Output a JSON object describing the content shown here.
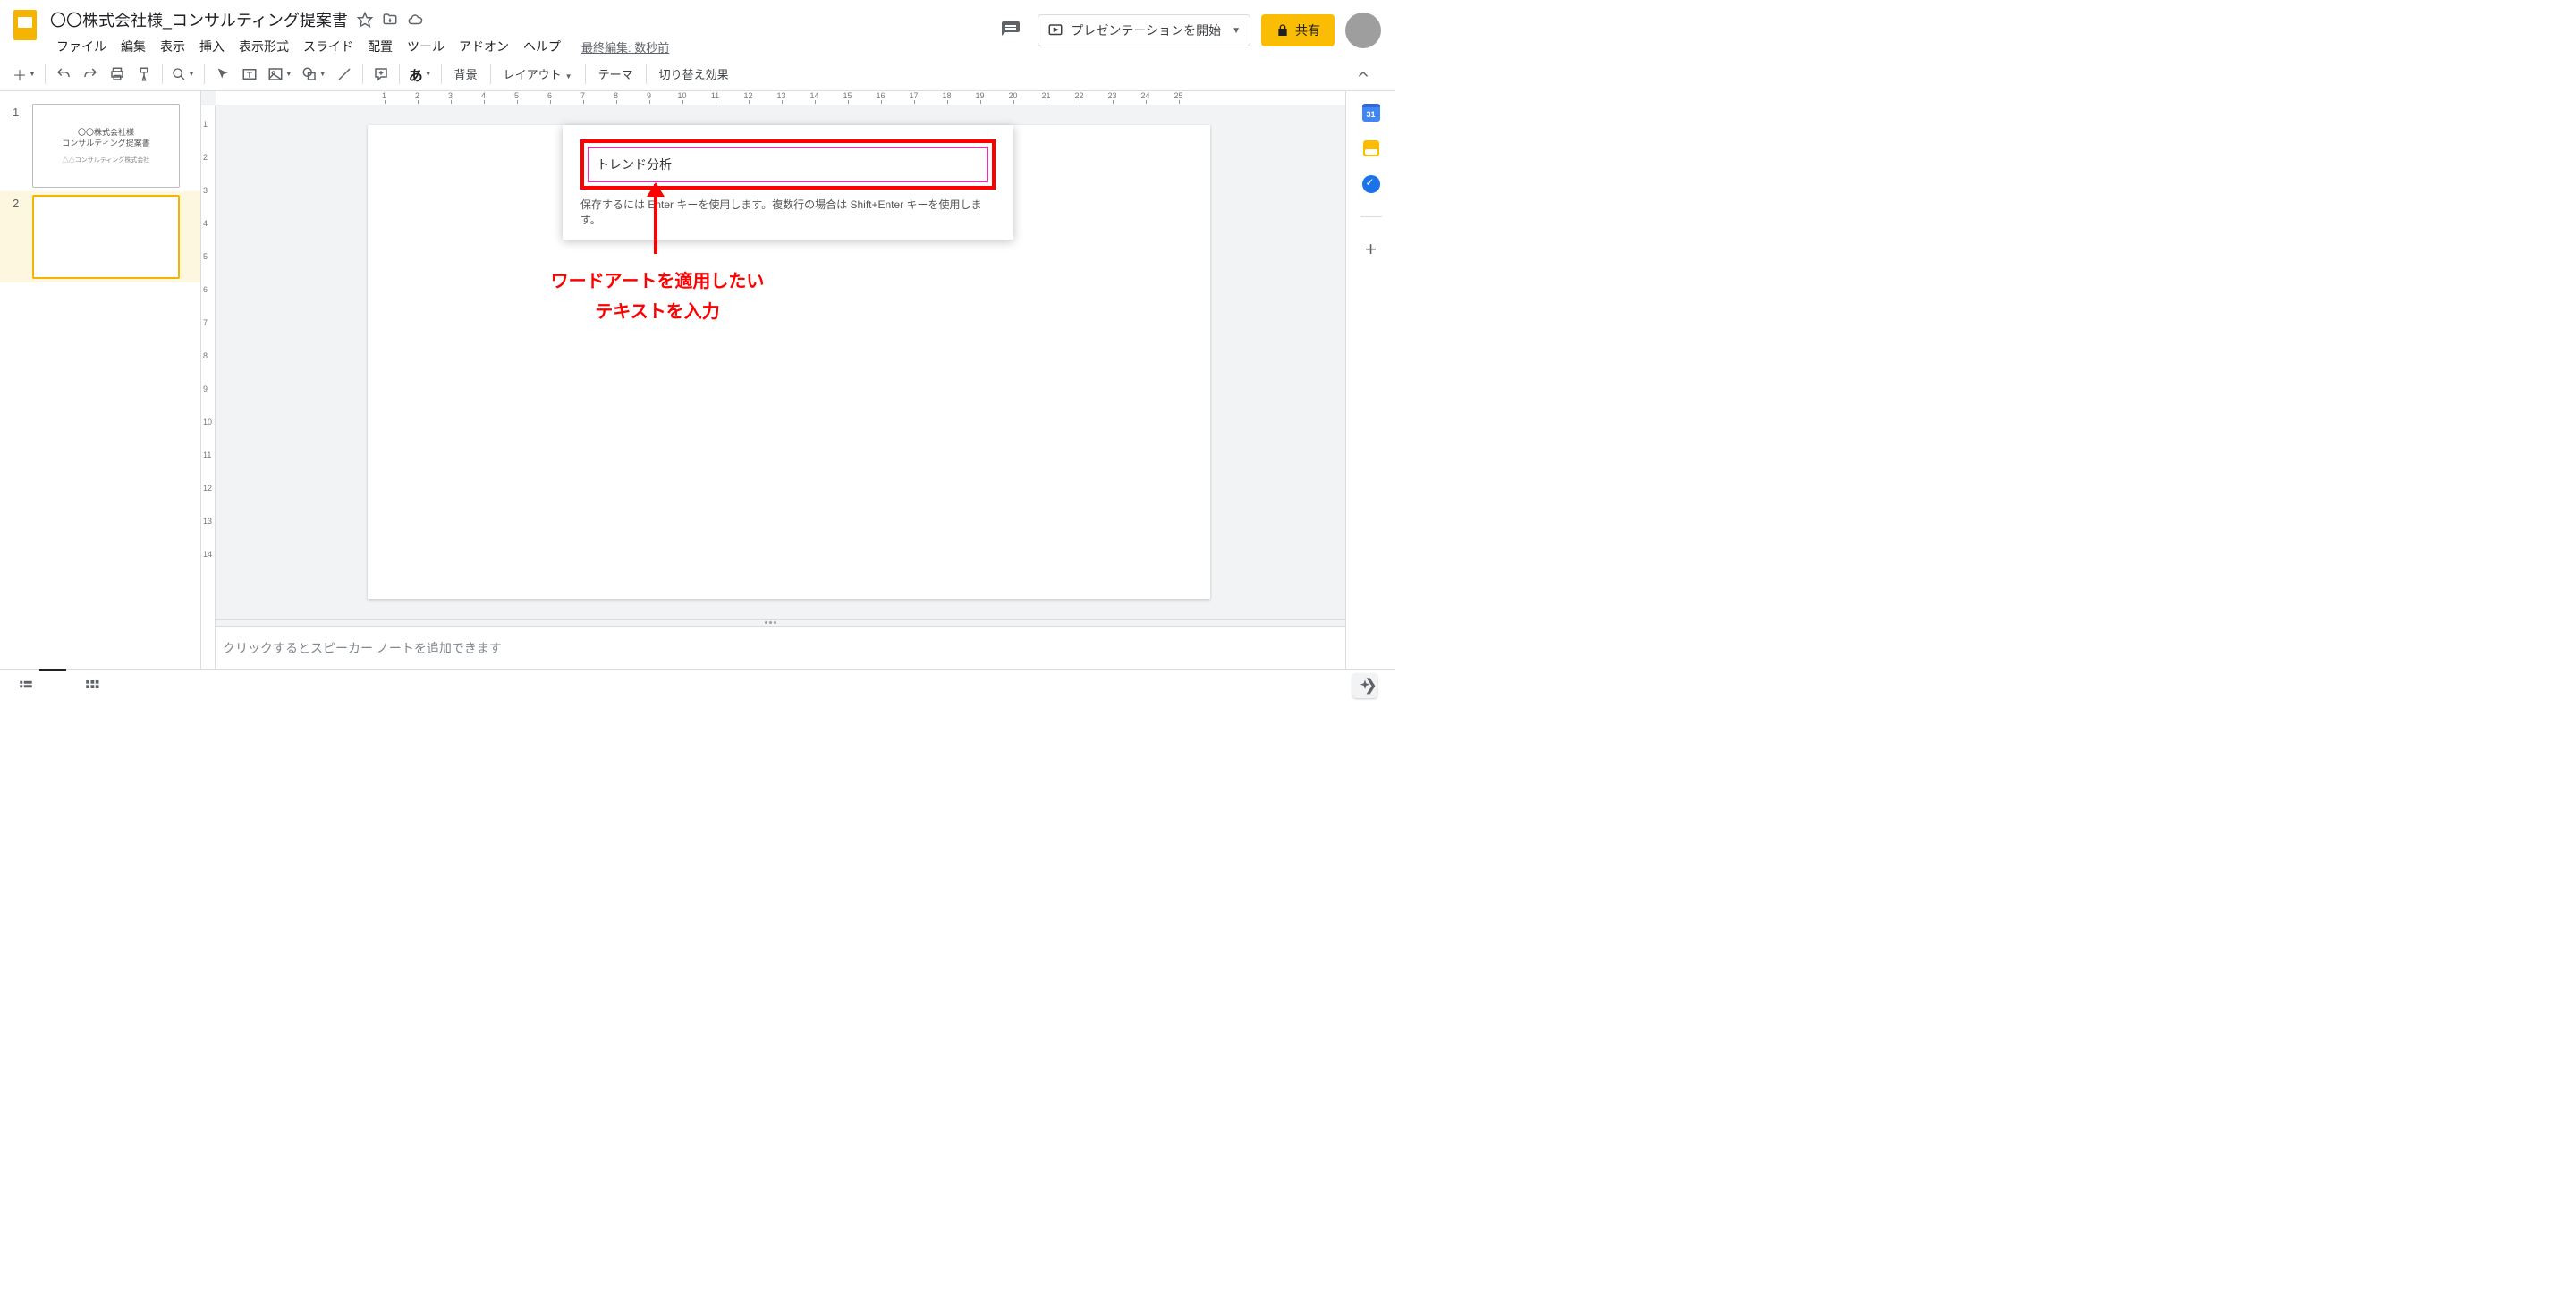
{
  "header": {
    "title": "〇〇株式会社様_コンサルティング提案書",
    "present_label": "プレゼンテーションを開始",
    "share_label": "共有",
    "last_edit": "最終編集: 数秒前"
  },
  "menus": [
    "ファイル",
    "編集",
    "表示",
    "挿入",
    "表示形式",
    "スライド",
    "配置",
    "ツール",
    "アドオン",
    "ヘルプ"
  ],
  "toolbar": {
    "input_method": "あ",
    "background": "背景",
    "layout": "レイアウト",
    "theme": "テーマ",
    "transition": "切り替え効果"
  },
  "slides": [
    {
      "num": "1",
      "line1": "〇〇株式会社様",
      "line2": "コンサルティング提案書",
      "sub": "△△コンサルティング株式会社"
    },
    {
      "num": "2",
      "line1": "",
      "line2": "",
      "sub": ""
    }
  ],
  "dialog": {
    "input_value": "トレンド分析",
    "hint": "保存するには Enter キーを使用します。複数行の場合は Shift+Enter キーを使用します。"
  },
  "annotation": {
    "line1": "ワードアートを適用したい",
    "line2": "テキストを入力"
  },
  "notes": {
    "placeholder": "クリックするとスピーカー ノートを追加できます"
  },
  "right_rail": {
    "calendar_day": "31"
  },
  "ruler_h": [
    "1",
    "2",
    "3",
    "4",
    "5",
    "6",
    "7",
    "8",
    "9",
    "10",
    "11",
    "12",
    "13",
    "14",
    "15",
    "16",
    "17",
    "18",
    "19",
    "20",
    "21",
    "22",
    "23",
    "24",
    "25"
  ],
  "ruler_v": [
    "1",
    "2",
    "3",
    "4",
    "5",
    "6",
    "7",
    "8",
    "9",
    "10",
    "11",
    "12",
    "13",
    "14"
  ]
}
